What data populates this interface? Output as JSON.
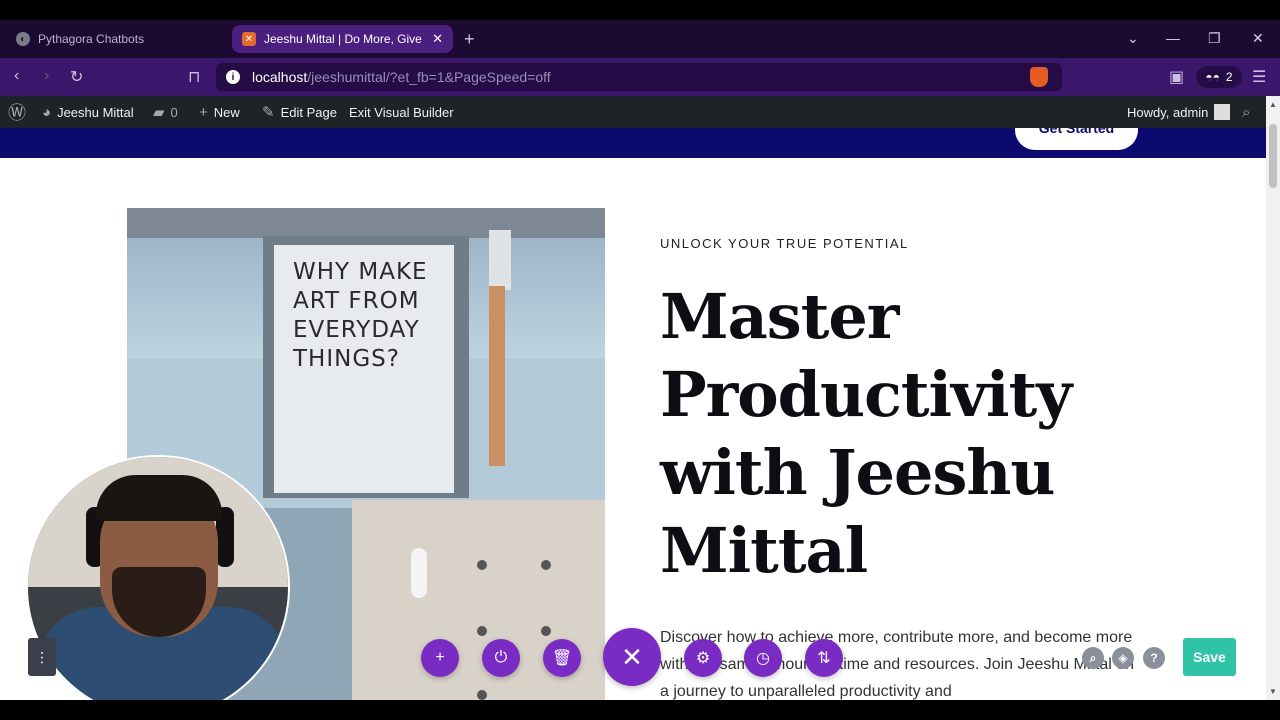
{
  "browser": {
    "tabs": [
      {
        "title": "Pythagora Chatbots",
        "active": false
      },
      {
        "title": "Jeeshu Mittal | Do More, Give Mor",
        "active": true
      }
    ],
    "url_host": "localhost",
    "url_path": "/jeeshumittal/?et_fb=1&PageSpeed=off",
    "wallet_count": "2",
    "brave_badge": "1"
  },
  "adminbar": {
    "site_name": "Jeeshu Mittal",
    "comments_count": "0",
    "new_label": "New",
    "edit_page_label": "Edit Page",
    "exit_vb_label": "Exit Visual Builder",
    "howdy": "Howdy, admin"
  },
  "header": {
    "cta_label": "Get Started"
  },
  "hero": {
    "poster_text": "WHY MAKE ART FROM EVERYDAY THINGS?",
    "eyebrow": "UNLOCK YOUR TRUE POTENTIAL",
    "headline": "Master Productivity with Jeeshu Mittal",
    "body": "Discover how to achieve more, contribute more, and become more with the same amount of time and resources. Join Jeeshu Mittal on a journey to unparalleled productivity and"
  },
  "builder": {
    "save_label": "Save",
    "icons": [
      "plus-icon",
      "power-icon",
      "trash-icon",
      "close-icon",
      "gear-icon",
      "history-icon",
      "portability-icon",
      "search-icon",
      "layers-icon",
      "help-icon"
    ]
  },
  "colors": {
    "tab_bar": "#1d0a33",
    "address_bar": "#3a176b",
    "active_tab": "#4a1f7f",
    "admin_bar": "#1d2327",
    "site_header": "#0c0a6e",
    "builder_purple": "#7a2bc4",
    "save_green": "#2ec4a5"
  }
}
